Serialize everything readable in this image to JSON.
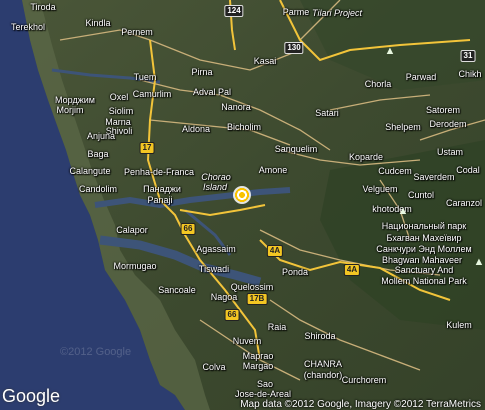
{
  "colors": {
    "sea": "#2b3c6e",
    "land": "#3e4a32",
    "road": "#c8b07a",
    "highway": "#f2c43a",
    "water": "#3a4f70"
  },
  "places": [
    {
      "name": "Tiroda"
    },
    {
      "name": "Terekhol"
    },
    {
      "name": "Kindla"
    },
    {
      "name": "Pernem"
    },
    {
      "name": "Parme"
    },
    {
      "name": "Tilari Project"
    },
    {
      "name": "Kasai"
    },
    {
      "name": "Tuem"
    },
    {
      "name": "Pirna"
    },
    {
      "name": "Морджим"
    },
    {
      "name": "Morjim"
    },
    {
      "name": "Oxel"
    },
    {
      "name": "Camurlim"
    },
    {
      "name": "Adval Pal"
    },
    {
      "name": "Siolim"
    },
    {
      "name": "Nanora"
    },
    {
      "name": "Satari"
    },
    {
      "name": "Chorla"
    },
    {
      "name": "Parwad"
    },
    {
      "name": "Chikh"
    },
    {
      "name": "Marna"
    },
    {
      "name": "Shivoli"
    },
    {
      "name": "Aldona"
    },
    {
      "name": "Bicholim"
    },
    {
      "name": "Satorem"
    },
    {
      "name": "Derodem"
    },
    {
      "name": "Anjuna"
    },
    {
      "name": "Baga"
    },
    {
      "name": "Sanquelim"
    },
    {
      "name": "Shelpem"
    },
    {
      "name": "Ustam"
    },
    {
      "name": "Koparde"
    },
    {
      "name": "Calangute"
    },
    {
      "name": "Penha-de-Franca"
    },
    {
      "name": "Chorao"
    },
    {
      "name": "Island"
    },
    {
      "name": "Amone"
    },
    {
      "name": "Cudcem"
    },
    {
      "name": "Codal"
    },
    {
      "name": "Candolim"
    },
    {
      "name": "Панаджи"
    },
    {
      "name": "Panaji"
    },
    {
      "name": "Saverdem"
    },
    {
      "name": "Velguem"
    },
    {
      "name": "Cuntol"
    },
    {
      "name": "Caranzol"
    },
    {
      "name": "khotodem"
    },
    {
      "name": "Национальный парк"
    },
    {
      "name": "Бхагван Махеївир"
    },
    {
      "name": "Санкчури Энд Моллем"
    },
    {
      "name": "Calapor"
    },
    {
      "name": "Agassaim"
    },
    {
      "name": "Bhagwan Mahaveer"
    },
    {
      "name": "Sanctuary And"
    },
    {
      "name": "Mollem National Park"
    },
    {
      "name": "Mormugao"
    },
    {
      "name": "Tiswadi"
    },
    {
      "name": "Ponda"
    },
    {
      "name": "Sancoale"
    },
    {
      "name": "Quelossim"
    },
    {
      "name": "Nagoa"
    },
    {
      "name": "Raia"
    },
    {
      "name": "Shiroda"
    },
    {
      "name": "Kulem"
    },
    {
      "name": "Nuvem"
    },
    {
      "name": "Маргао"
    },
    {
      "name": "Margao"
    },
    {
      "name": "CHANRA"
    },
    {
      "name": "(chandor)"
    },
    {
      "name": "Colva"
    },
    {
      "name": "Sao"
    },
    {
      "name": "Jose-de-Areal"
    },
    {
      "name": "Curchorem"
    }
  ],
  "shields": [
    {
      "label": "124"
    },
    {
      "label": "130"
    },
    {
      "label": "31"
    },
    {
      "label": "17"
    },
    {
      "label": "66"
    },
    {
      "label": "4A"
    },
    {
      "label": "4A"
    },
    {
      "label": "17B"
    },
    {
      "label": "66"
    }
  ],
  "branding": {
    "logo": "Google",
    "copyright": "Map data ©2012 Google, Imagery ©2012 TerraMetrics",
    "watermark": "©2012 Google"
  }
}
